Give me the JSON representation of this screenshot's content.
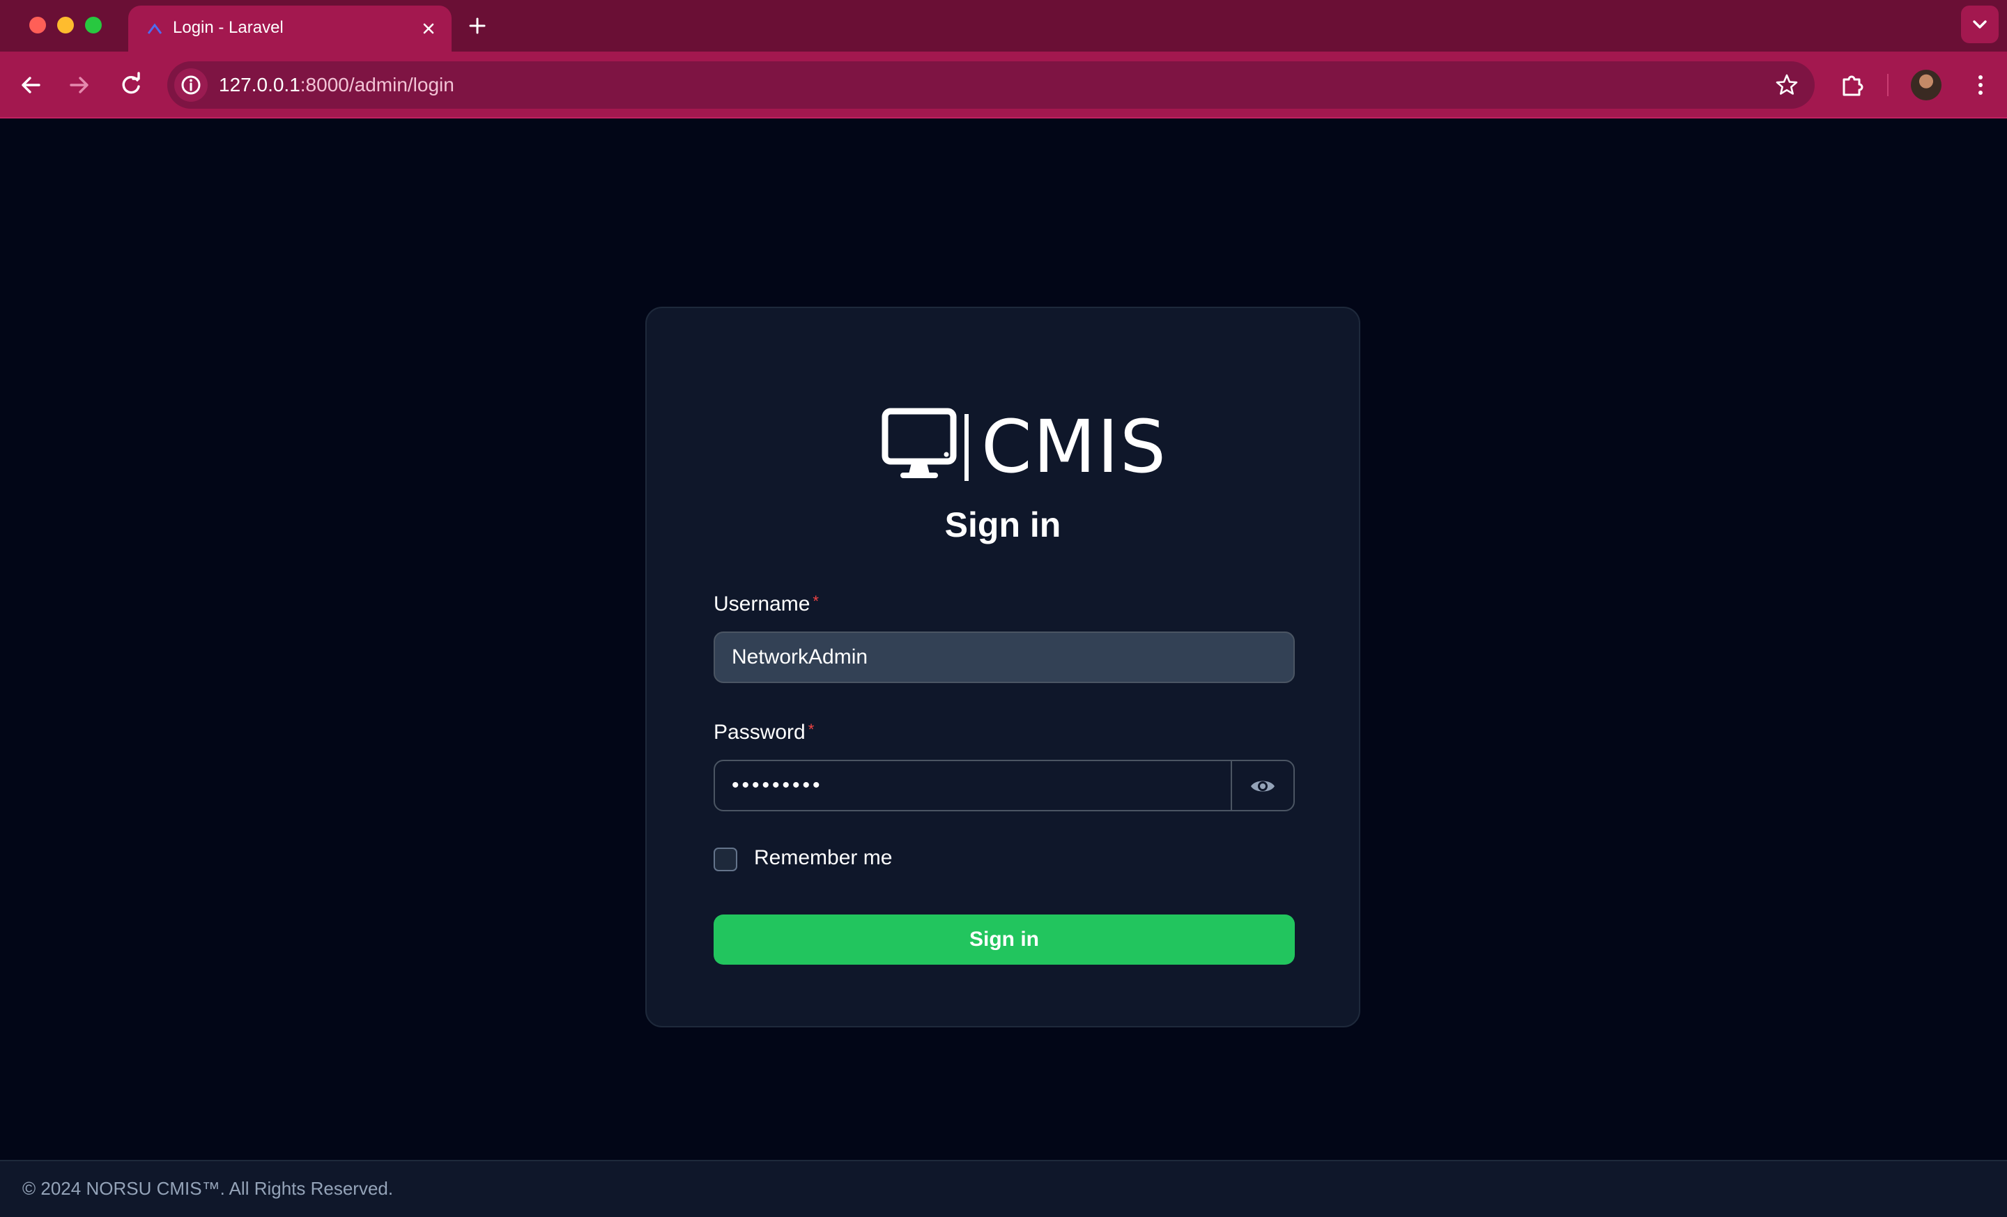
{
  "browser": {
    "tab_title": "Login - Laravel",
    "url_host": "127.0.0.1",
    "url_path": ":8000/admin/login",
    "accent_color": "#a3184f"
  },
  "logo": {
    "text": "CMIS",
    "icon": "monitor-icon"
  },
  "form": {
    "heading": "Sign in",
    "username_label": "Username",
    "username_value": "NetworkAdmin",
    "password_label": "Password",
    "password_value": "•••••••••",
    "required_marker": "*",
    "remember_label": "Remember me",
    "remember_checked": false,
    "submit_label": "Sign in",
    "submit_color": "#22c55e"
  },
  "footer": {
    "text": "© 2024 NORSU CMIS™. All Rights Reserved."
  }
}
